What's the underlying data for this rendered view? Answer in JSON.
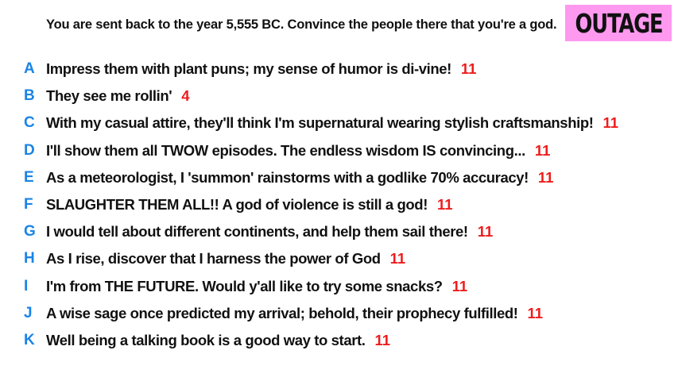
{
  "prompt": "You are sent back to the year 5,555 BC. Convince the people there that you're a god.",
  "badge": {
    "label": "OUTAGE",
    "color": "#ff99f0"
  },
  "colors": {
    "letter": "#1a84e6",
    "count": "#ee1c1c",
    "text": "#111111"
  },
  "responses": [
    {
      "letter": "A",
      "text": "Impress them with plant puns; my sense of humor is di-vine!",
      "count": "11"
    },
    {
      "letter": "B",
      "text": "They see me rollin'",
      "count": "4"
    },
    {
      "letter": "C",
      "text": "With my casual attire, they'll think I'm supernatural wearing stylish craftsmanship!",
      "count": "11"
    },
    {
      "letter": "D",
      "text": "I'll show them all TWOW episodes. The endless wisdom IS convincing...",
      "count": "11"
    },
    {
      "letter": "E",
      "text": "As a meteorologist, I 'summon' rainstorms with a godlike 70% accuracy!",
      "count": "11"
    },
    {
      "letter": "F",
      "text": "SLAUGHTER THEM ALL!! A god of violence is still a god!",
      "count": "11"
    },
    {
      "letter": "G",
      "text": "I would tell about different continents, and help them sail there!",
      "count": "11"
    },
    {
      "letter": "H",
      "text": "As I rise, discover that I harness the power of God",
      "count": "11"
    },
    {
      "letter": "I",
      "text": "I'm from THE FUTURE. Would y'all like to try some snacks?",
      "count": "11"
    },
    {
      "letter": "J",
      "text": "A wise sage once predicted my arrival; behold, their prophecy fulfilled!",
      "count": "11"
    },
    {
      "letter": "K",
      "text": "Well being a talking book is a good way to start.",
      "count": "11"
    }
  ]
}
